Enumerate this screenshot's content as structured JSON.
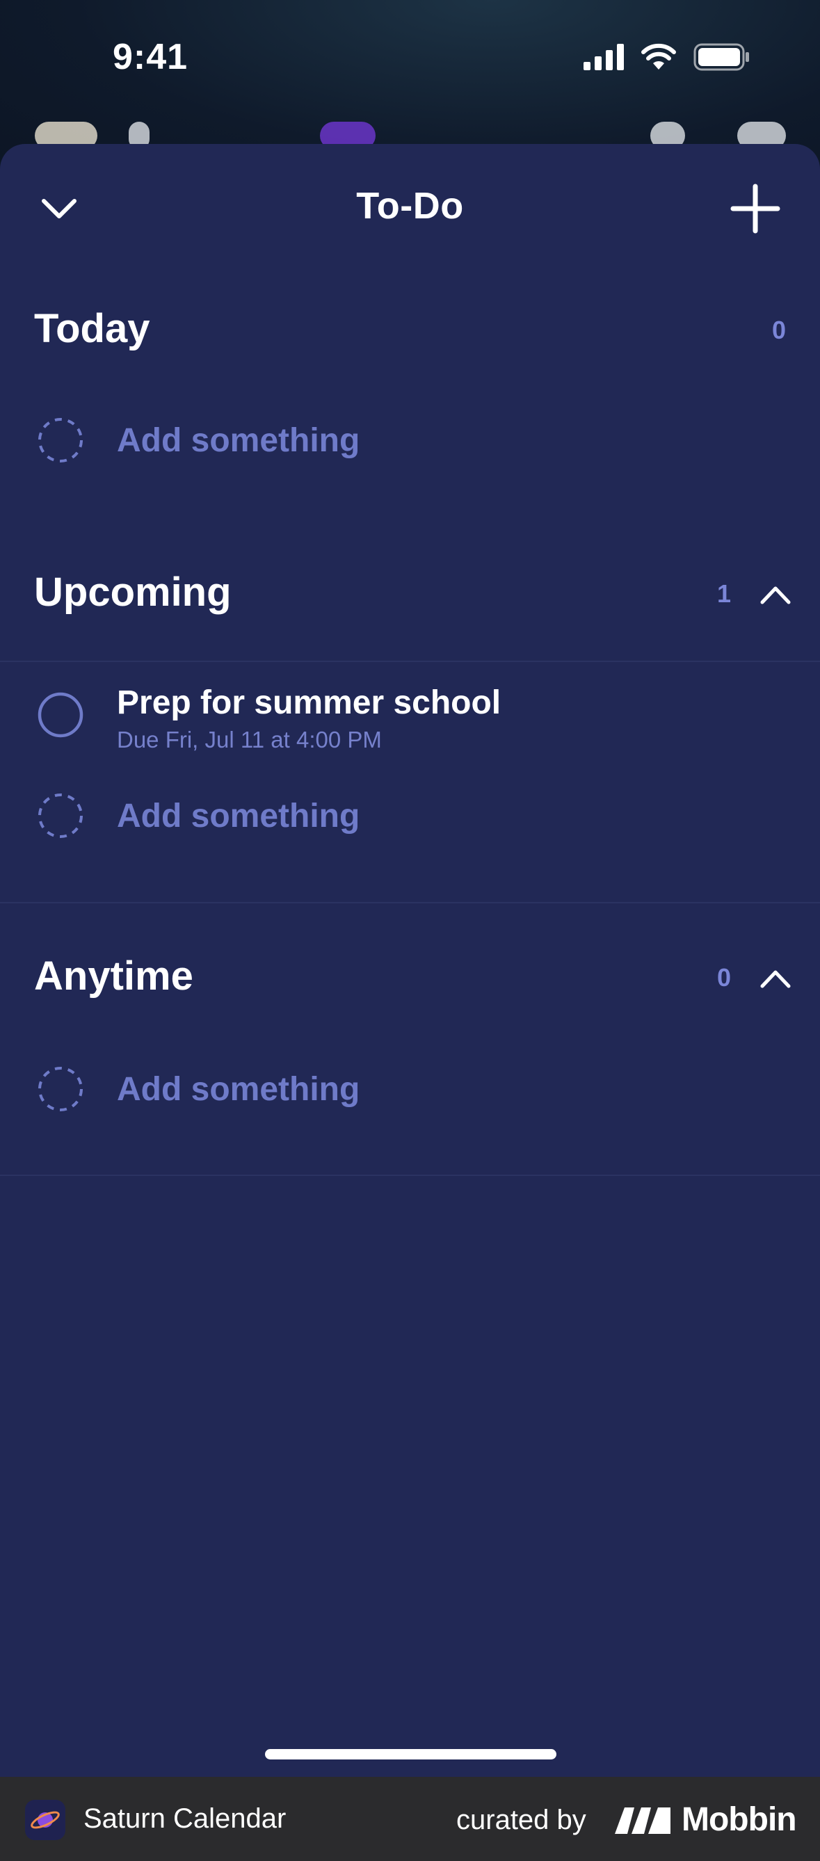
{
  "status_bar": {
    "time": "9:41"
  },
  "sheet": {
    "title": "To-Do",
    "sections": [
      {
        "title": "Today",
        "count": "0",
        "add_placeholder": "Add something"
      },
      {
        "title": "Upcoming",
        "count": "1",
        "tasks": [
          {
            "title": "Prep for summer school",
            "due": "Due Fri, Jul 11 at 4:00 PM"
          }
        ],
        "add_placeholder": "Add something"
      },
      {
        "title": "Anytime",
        "count": "0",
        "add_placeholder": "Add something"
      }
    ]
  },
  "footer": {
    "app_name": "Saturn Calendar",
    "curated_by": "curated by",
    "brand": "Mobbin"
  },
  "colors": {
    "sheet_bg": "#212855",
    "accent_muted": "#6f7bc9",
    "count": "#7b86d8",
    "footer_bg": "#2b2b2d"
  },
  "icons": {
    "collapse": "chevron-down-icon",
    "add": "plus-icon",
    "section_toggle": "chevron-up-icon",
    "add_row": "dashed-circle-icon",
    "task": "empty-circle-icon"
  }
}
